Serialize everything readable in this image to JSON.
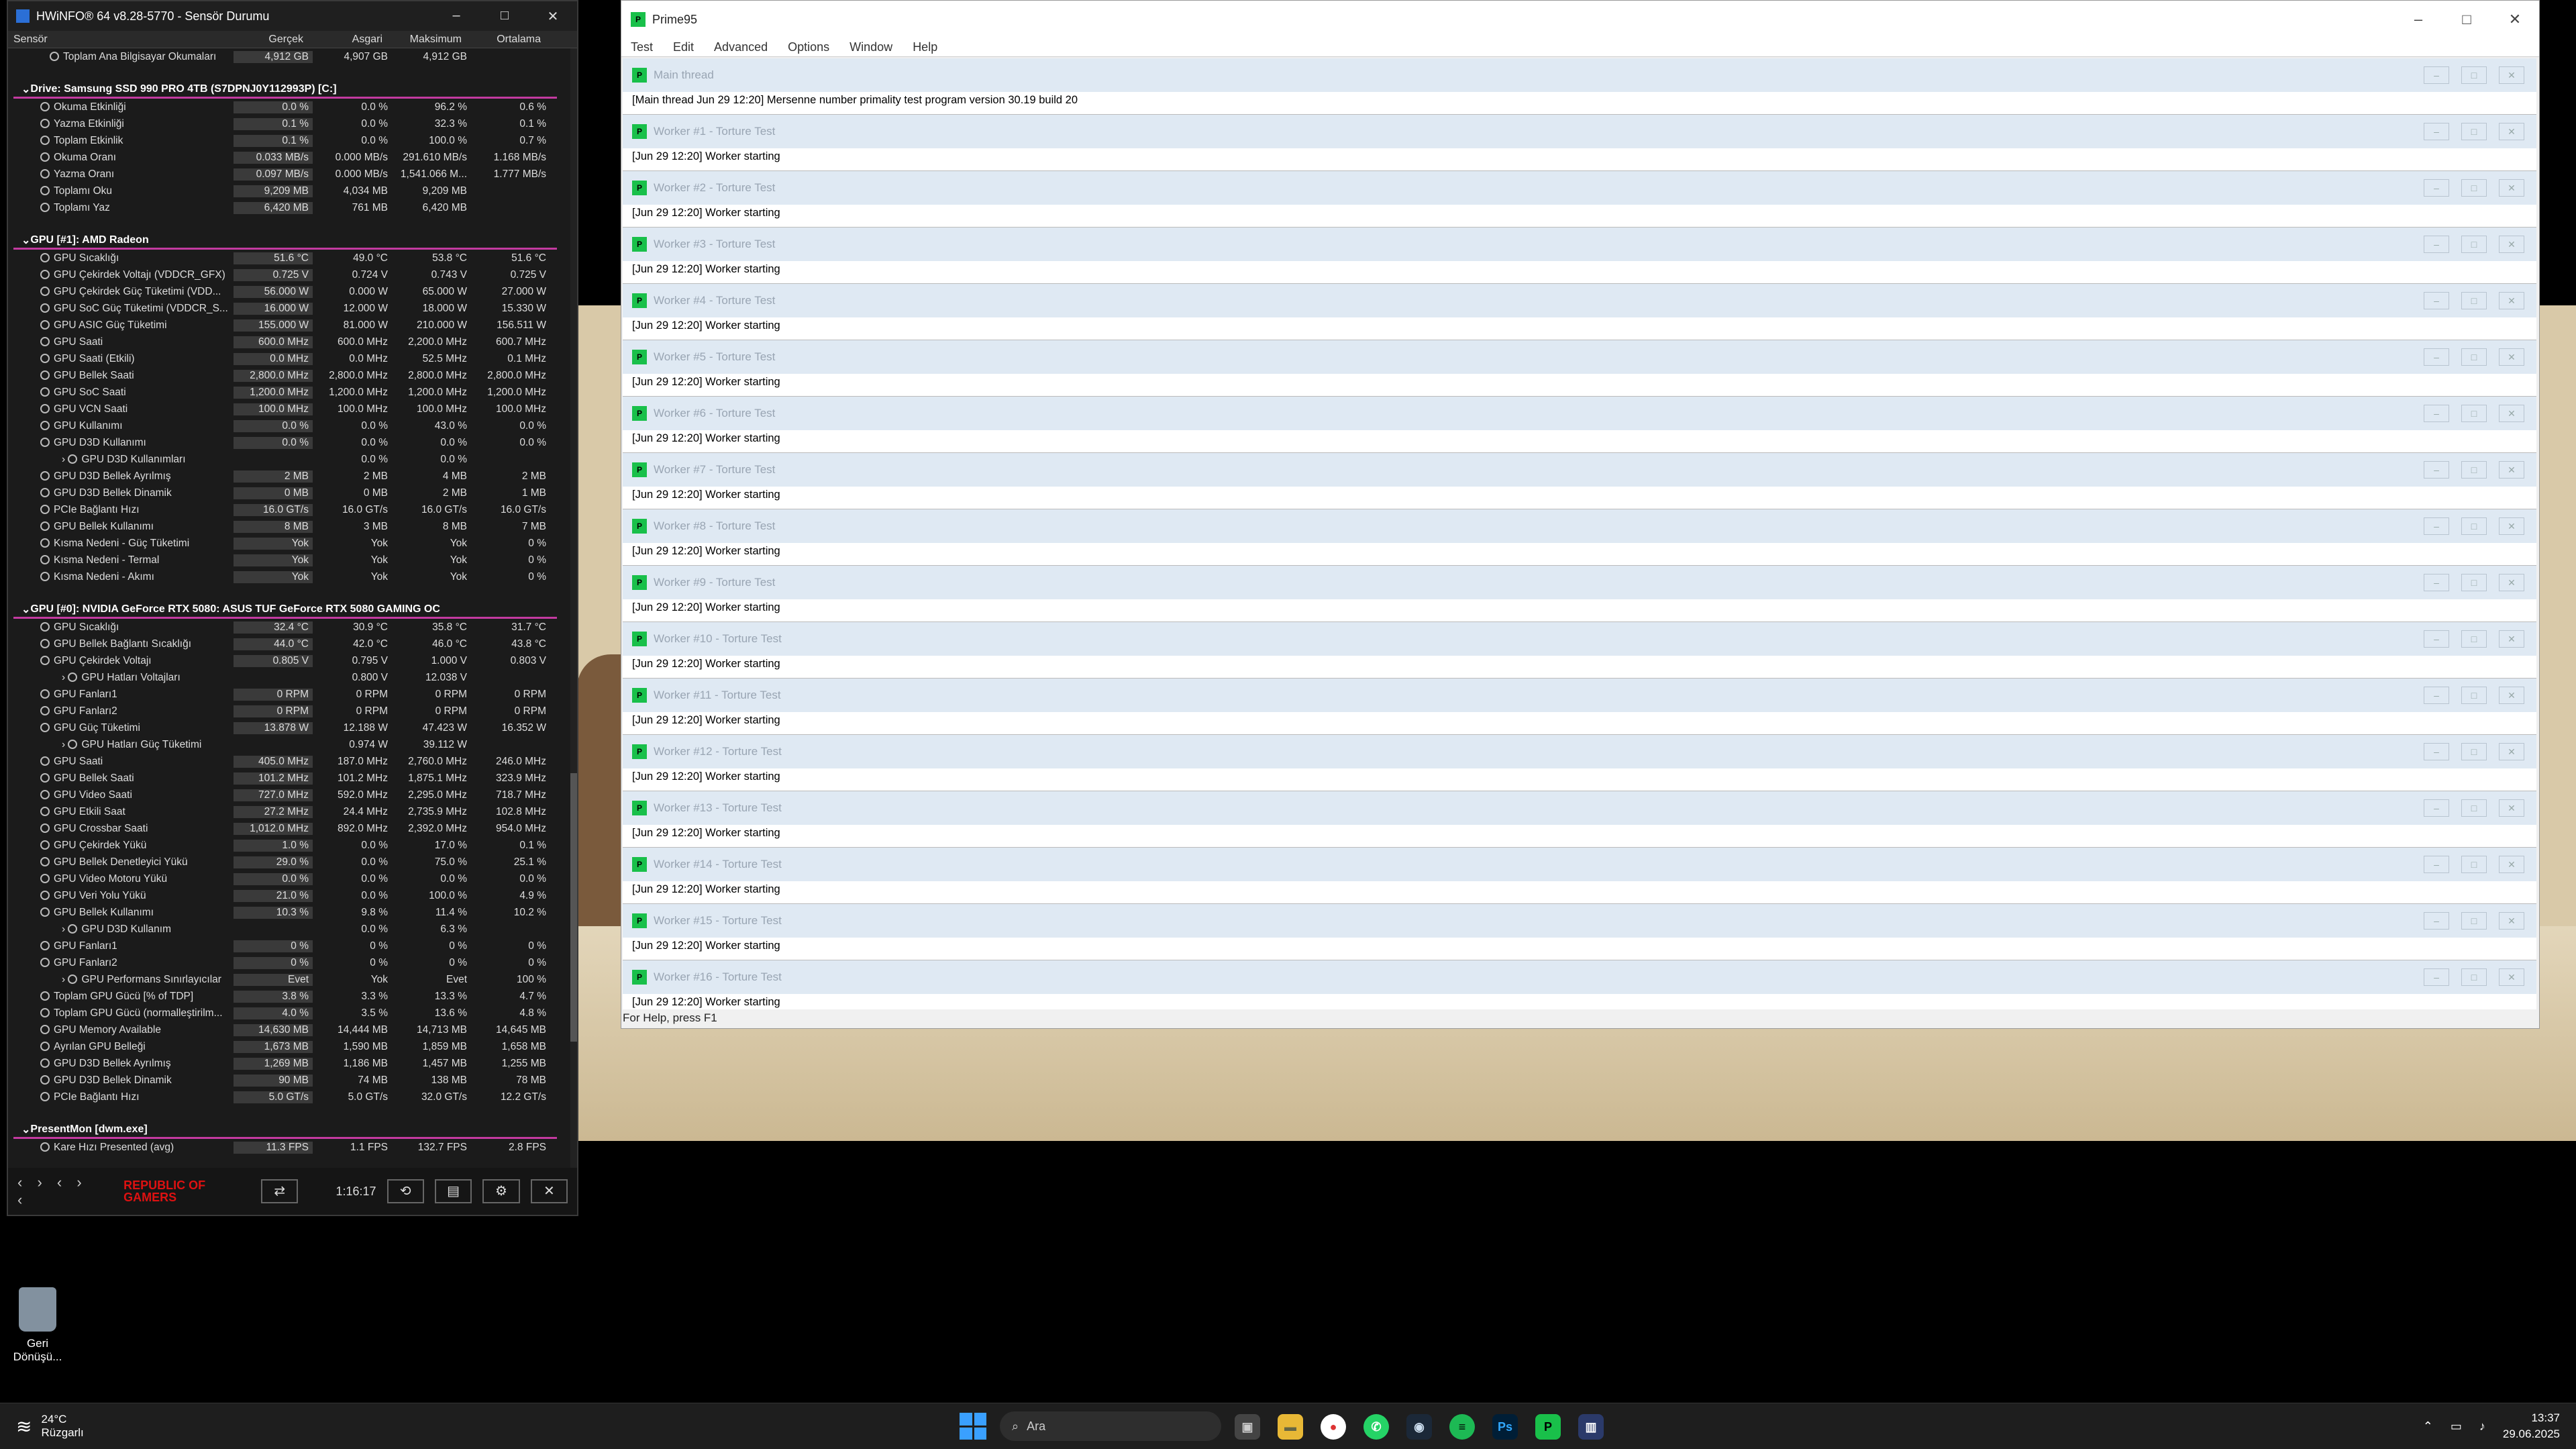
{
  "hwinfo": {
    "title": "HWiNFO® 64 v8.28-5770 - Sensör Durumu",
    "columns": [
      "Sensör",
      "Gerçek",
      "Asgari",
      "Maksimum",
      "Ortalama"
    ],
    "rows": [
      {
        "t": "row",
        "i": 2,
        "n": "Toplam Ana Bilgisayar Okumaları",
        "v": [
          "4,912 GB",
          "4,907 GB",
          "4,912 GB",
          ""
        ]
      },
      {
        "t": "gap"
      },
      {
        "t": "grp",
        "n": "Drive: Samsung SSD 990 PRO 4TB (S7DPNJ0Y112993P) [C:]"
      },
      {
        "t": "row",
        "i": 1,
        "n": "Okuma Etkinliği",
        "v": [
          "0.0 %",
          "0.0 %",
          "96.2 %",
          "0.6 %"
        ]
      },
      {
        "t": "row",
        "i": 1,
        "n": "Yazma Etkinliği",
        "v": [
          "0.1 %",
          "0.0 %",
          "32.3 %",
          "0.1 %"
        ]
      },
      {
        "t": "row",
        "i": 1,
        "n": "Toplam Etkinlik",
        "v": [
          "0.1 %",
          "0.0 %",
          "100.0 %",
          "0.7 %"
        ]
      },
      {
        "t": "row",
        "i": 1,
        "n": "Okuma Oranı",
        "v": [
          "0.033 MB/s",
          "0.000 MB/s",
          "291.610 MB/s",
          "1.168 MB/s"
        ]
      },
      {
        "t": "row",
        "i": 1,
        "n": "Yazma Oranı",
        "v": [
          "0.097 MB/s",
          "0.000 MB/s",
          "1,541.066 M...",
          "1.777 MB/s"
        ]
      },
      {
        "t": "row",
        "i": 1,
        "n": "Toplamı Oku",
        "v": [
          "9,209 MB",
          "4,034 MB",
          "9,209 MB",
          ""
        ]
      },
      {
        "t": "row",
        "i": 1,
        "n": "Toplamı Yaz",
        "v": [
          "6,420 MB",
          "761 MB",
          "6,420 MB",
          ""
        ]
      },
      {
        "t": "gap"
      },
      {
        "t": "grp",
        "n": "GPU [#1]: AMD Radeon"
      },
      {
        "t": "row",
        "i": 1,
        "n": "GPU Sıcaklığı",
        "v": [
          "51.6 °C",
          "49.0 °C",
          "53.8 °C",
          "51.6 °C"
        ]
      },
      {
        "t": "row",
        "i": 1,
        "n": "GPU Çekirdek Voltajı (VDDCR_GFX)",
        "v": [
          "0.725 V",
          "0.724 V",
          "0.743 V",
          "0.725 V"
        ]
      },
      {
        "t": "row",
        "i": 1,
        "n": "GPU Çekirdek Güç Tüketimi (VDD...",
        "v": [
          "56.000 W",
          "0.000 W",
          "65.000 W",
          "27.000 W"
        ]
      },
      {
        "t": "row",
        "i": 1,
        "n": "GPU SoC Güç Tüketimi (VDDCR_S...",
        "v": [
          "16.000 W",
          "12.000 W",
          "18.000 W",
          "15.330 W"
        ]
      },
      {
        "t": "row",
        "i": 1,
        "n": "GPU ASIC Güç Tüketimi",
        "v": [
          "155.000 W",
          "81.000 W",
          "210.000 W",
          "156.511 W"
        ]
      },
      {
        "t": "row",
        "i": 1,
        "n": "GPU Saati",
        "v": [
          "600.0 MHz",
          "600.0 MHz",
          "2,200.0 MHz",
          "600.7 MHz"
        ]
      },
      {
        "t": "row",
        "i": 1,
        "n": "GPU Saati (Etkili)",
        "v": [
          "0.0 MHz",
          "0.0 MHz",
          "52.5 MHz",
          "0.1 MHz"
        ]
      },
      {
        "t": "row",
        "i": 1,
        "n": "GPU Bellek Saati",
        "v": [
          "2,800.0 MHz",
          "2,800.0 MHz",
          "2,800.0 MHz",
          "2,800.0 MHz"
        ]
      },
      {
        "t": "row",
        "i": 1,
        "n": "GPU SoC Saati",
        "v": [
          "1,200.0 MHz",
          "1,200.0 MHz",
          "1,200.0 MHz",
          "1,200.0 MHz"
        ]
      },
      {
        "t": "row",
        "i": 1,
        "n": "GPU VCN Saati",
        "v": [
          "100.0 MHz",
          "100.0 MHz",
          "100.0 MHz",
          "100.0 MHz"
        ]
      },
      {
        "t": "row",
        "i": 1,
        "n": "GPU Kullanımı",
        "v": [
          "0.0 %",
          "0.0 %",
          "43.0 %",
          "0.0 %"
        ]
      },
      {
        "t": "row",
        "i": 1,
        "n": "GPU D3D Kullanımı",
        "v": [
          "0.0 %",
          "0.0 %",
          "0.0 %",
          "0.0 %"
        ]
      },
      {
        "t": "row",
        "i": 3,
        "n": "GPU D3D Kullanımları",
        "v": [
          "",
          "0.0 %",
          "0.0 %",
          ""
        ]
      },
      {
        "t": "row",
        "i": 1,
        "n": "GPU D3D Bellek Ayrılmış",
        "v": [
          "2 MB",
          "2 MB",
          "4 MB",
          "2 MB"
        ]
      },
      {
        "t": "row",
        "i": 1,
        "n": "GPU D3D Bellek Dinamik",
        "v": [
          "0 MB",
          "0 MB",
          "2 MB",
          "1 MB"
        ]
      },
      {
        "t": "row",
        "i": 1,
        "n": "PCIe Bağlantı Hızı",
        "v": [
          "16.0 GT/s",
          "16.0 GT/s",
          "16.0 GT/s",
          "16.0 GT/s"
        ]
      },
      {
        "t": "row",
        "i": 1,
        "n": "GPU Bellek Kullanımı",
        "v": [
          "8 MB",
          "3 MB",
          "8 MB",
          "7 MB"
        ]
      },
      {
        "t": "row",
        "i": 1,
        "n": "Kısma Nedeni - Güç Tüketimi",
        "v": [
          "Yok",
          "Yok",
          "Yok",
          "0 %"
        ]
      },
      {
        "t": "row",
        "i": 1,
        "n": "Kısma Nedeni - Termal",
        "v": [
          "Yok",
          "Yok",
          "Yok",
          "0 %"
        ]
      },
      {
        "t": "row",
        "i": 1,
        "n": "Kısma Nedeni - Akımı",
        "v": [
          "Yok",
          "Yok",
          "Yok",
          "0 %"
        ]
      },
      {
        "t": "gap"
      },
      {
        "t": "grp",
        "n": "GPU [#0]: NVIDIA GeForce RTX 5080: ASUS TUF GeForce RTX 5080 GAMING OC"
      },
      {
        "t": "row",
        "i": 1,
        "n": "GPU Sıcaklığı",
        "v": [
          "32.4 °C",
          "30.9 °C",
          "35.8 °C",
          "31.7 °C"
        ]
      },
      {
        "t": "row",
        "i": 1,
        "n": "GPU Bellek Bağlantı Sıcaklığı",
        "v": [
          "44.0 °C",
          "42.0 °C",
          "46.0 °C",
          "43.8 °C"
        ]
      },
      {
        "t": "row",
        "i": 1,
        "n": "GPU Çekirdek Voltajı",
        "v": [
          "0.805 V",
          "0.795 V",
          "1.000 V",
          "0.803 V"
        ]
      },
      {
        "t": "row",
        "i": 3,
        "n": "GPU Hatları Voltajları",
        "v": [
          "",
          "0.800 V",
          "12.038 V",
          ""
        ]
      },
      {
        "t": "row",
        "i": 1,
        "n": "GPU Fanları1",
        "v": [
          "0 RPM",
          "0 RPM",
          "0 RPM",
          "0 RPM"
        ]
      },
      {
        "t": "row",
        "i": 1,
        "n": "GPU Fanları2",
        "v": [
          "0 RPM",
          "0 RPM",
          "0 RPM",
          "0 RPM"
        ]
      },
      {
        "t": "row",
        "i": 1,
        "n": "GPU Güç Tüketimi",
        "v": [
          "13.878 W",
          "12.188 W",
          "47.423 W",
          "16.352 W"
        ]
      },
      {
        "t": "row",
        "i": 3,
        "n": "GPU Hatları Güç Tüketimi",
        "v": [
          "",
          "0.974 W",
          "39.112 W",
          ""
        ]
      },
      {
        "t": "row",
        "i": 1,
        "n": "GPU Saati",
        "v": [
          "405.0 MHz",
          "187.0 MHz",
          "2,760.0 MHz",
          "246.0 MHz"
        ]
      },
      {
        "t": "row",
        "i": 1,
        "n": "GPU Bellek Saati",
        "v": [
          "101.2 MHz",
          "101.2 MHz",
          "1,875.1 MHz",
          "323.9 MHz"
        ]
      },
      {
        "t": "row",
        "i": 1,
        "n": "GPU Video Saati",
        "v": [
          "727.0 MHz",
          "592.0 MHz",
          "2,295.0 MHz",
          "718.7 MHz"
        ]
      },
      {
        "t": "row",
        "i": 1,
        "n": "GPU Etkili Saat",
        "v": [
          "27.2 MHz",
          "24.4 MHz",
          "2,735.9 MHz",
          "102.8 MHz"
        ]
      },
      {
        "t": "row",
        "i": 1,
        "n": "GPU Crossbar Saati",
        "v": [
          "1,012.0 MHz",
          "892.0 MHz",
          "2,392.0 MHz",
          "954.0 MHz"
        ]
      },
      {
        "t": "row",
        "i": 1,
        "n": "GPU Çekirdek Yükü",
        "v": [
          "1.0 %",
          "0.0 %",
          "17.0 %",
          "0.1 %"
        ]
      },
      {
        "t": "row",
        "i": 1,
        "n": "GPU Bellek Denetleyici Yükü",
        "v": [
          "29.0 %",
          "0.0 %",
          "75.0 %",
          "25.1 %"
        ]
      },
      {
        "t": "row",
        "i": 1,
        "n": "GPU Video Motoru Yükü",
        "v": [
          "0.0 %",
          "0.0 %",
          "0.0 %",
          "0.0 %"
        ]
      },
      {
        "t": "row",
        "i": 1,
        "n": "GPU Veri Yolu Yükü",
        "v": [
          "21.0 %",
          "0.0 %",
          "100.0 %",
          "4.9 %"
        ]
      },
      {
        "t": "row",
        "i": 1,
        "n": "GPU Bellek Kullanımı",
        "v": [
          "10.3 %",
          "9.8 %",
          "11.4 %",
          "10.2 %"
        ]
      },
      {
        "t": "row",
        "i": 3,
        "n": "GPU D3D Kullanım",
        "v": [
          "",
          "0.0 %",
          "6.3 %",
          ""
        ]
      },
      {
        "t": "row",
        "i": 1,
        "n": "GPU Fanları1",
        "v": [
          "0 %",
          "0 %",
          "0 %",
          "0 %"
        ]
      },
      {
        "t": "row",
        "i": 1,
        "n": "GPU Fanları2",
        "v": [
          "0 %",
          "0 %",
          "0 %",
          "0 %"
        ]
      },
      {
        "t": "row",
        "i": 3,
        "n": "GPU Performans Sınırlayıcılar",
        "v": [
          "Evet",
          "Yok",
          "Evet",
          "100 %"
        ]
      },
      {
        "t": "row",
        "i": 1,
        "n": "Toplam GPU Gücü [% of TDP]",
        "v": [
          "3.8 %",
          "3.3 %",
          "13.3 %",
          "4.7 %"
        ]
      },
      {
        "t": "row",
        "i": 1,
        "n": "Toplam GPU Gücü (normalleştirilm...",
        "v": [
          "4.0 %",
          "3.5 %",
          "13.6 %",
          "4.8 %"
        ]
      },
      {
        "t": "row",
        "i": 1,
        "n": "GPU Memory Available",
        "v": [
          "14,630 MB",
          "14,444 MB",
          "14,713 MB",
          "14,645 MB"
        ]
      },
      {
        "t": "row",
        "i": 1,
        "n": "Ayrılan GPU Belleği",
        "v": [
          "1,673 MB",
          "1,590 MB",
          "1,859 MB",
          "1,658 MB"
        ]
      },
      {
        "t": "row",
        "i": 1,
        "n": "GPU D3D Bellek Ayrılmış",
        "v": [
          "1,269 MB",
          "1,186 MB",
          "1,457 MB",
          "1,255 MB"
        ]
      },
      {
        "t": "row",
        "i": 1,
        "n": "GPU D3D Bellek Dinamik",
        "v": [
          "90 MB",
          "74 MB",
          "138 MB",
          "78 MB"
        ]
      },
      {
        "t": "row",
        "i": 1,
        "n": "PCIe Bağlantı Hızı",
        "v": [
          "5.0 GT/s",
          "5.0 GT/s",
          "32.0 GT/s",
          "12.2 GT/s"
        ]
      },
      {
        "t": "gap"
      },
      {
        "t": "grp",
        "n": "PresentMon [dwm.exe]"
      },
      {
        "t": "row",
        "i": 1,
        "n": "Kare Hızı Presented (avg)",
        "v": [
          "11.3 FPS",
          "1.1 FPS",
          "132.7 FPS",
          "2.8 FPS"
        ]
      }
    ],
    "footer": {
      "brand": "REPUBLIC OF GAMERS",
      "time": "1:16:17"
    }
  },
  "prime95": {
    "title": "Prime95",
    "menu": [
      "Test",
      "Edit",
      "Advanced",
      "Options",
      "Window",
      "Help"
    ],
    "main": {
      "title": "Main thread",
      "line": "[Main thread Jun 29 12:20] Mersenne number primality test program version 30.19 build 20"
    },
    "workers": [
      {
        "title": "Worker #1 - Torture Test",
        "line": "[Jun 29 12:20] Worker starting"
      },
      {
        "title": "Worker #2 - Torture Test",
        "line": "[Jun 29 12:20] Worker starting"
      },
      {
        "title": "Worker #3 - Torture Test",
        "line": "[Jun 29 12:20] Worker starting"
      },
      {
        "title": "Worker #4 - Torture Test",
        "line": "[Jun 29 12:20] Worker starting"
      },
      {
        "title": "Worker #5 - Torture Test",
        "line": "[Jun 29 12:20] Worker starting"
      },
      {
        "title": "Worker #6 - Torture Test",
        "line": "[Jun 29 12:20] Worker starting"
      },
      {
        "title": "Worker #7 - Torture Test",
        "line": "[Jun 29 12:20] Worker starting"
      },
      {
        "title": "Worker #8 - Torture Test",
        "line": "[Jun 29 12:20] Worker starting"
      },
      {
        "title": "Worker #9 - Torture Test",
        "line": "[Jun 29 12:20] Worker starting"
      },
      {
        "title": "Worker #10 - Torture Test",
        "line": "[Jun 29 12:20] Worker starting"
      },
      {
        "title": "Worker #11 - Torture Test",
        "line": "[Jun 29 12:20] Worker starting"
      },
      {
        "title": "Worker #12 - Torture Test",
        "line": "[Jun 29 12:20] Worker starting"
      },
      {
        "title": "Worker #13 - Torture Test",
        "line": "[Jun 29 12:20] Worker starting"
      },
      {
        "title": "Worker #14 - Torture Test",
        "line": "[Jun 29 12:20] Worker starting"
      },
      {
        "title": "Worker #15 - Torture Test",
        "line": "[Jun 29 12:20] Worker starting"
      },
      {
        "title": "Worker #16 - Torture Test",
        "line": "[Jun 29 12:20] Worker starting"
      }
    ],
    "status": "For Help, press F1"
  },
  "desktop": {
    "recycle_bin": "Geri Dönüşü..."
  },
  "taskbar": {
    "temp": "24°C",
    "weather": "Rüzgarlı",
    "search_placeholder": "Ara",
    "time": "13:37",
    "date": "29.06.2025"
  }
}
